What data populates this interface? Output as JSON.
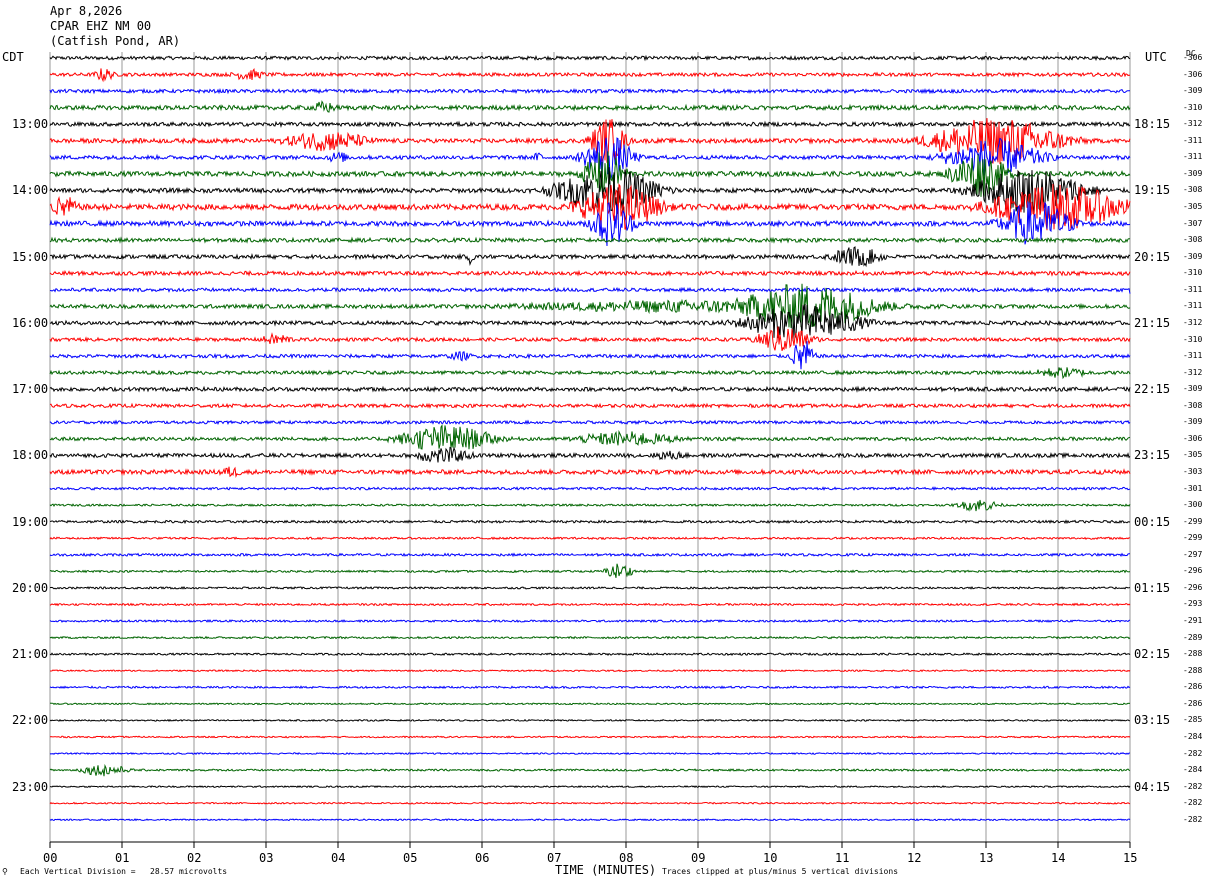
{
  "header": {
    "date": "Apr 8,2026",
    "station": "CPAR EHZ NM 00",
    "location": "(Catfish Pond, AR)"
  },
  "footer": {
    "scale_note": "Each Vertical Division =   28.57 microvolts",
    "clip_note": "Traces clipped at plus/minus 5 vertical divisions"
  },
  "chart_data": {
    "type": "line",
    "title": "CPAR EHZ NM 00 (Catfish Pond, AR) Apr 8,2026",
    "xlabel": "TIME (MINUTES)",
    "x_ticks": [
      "00",
      "01",
      "02",
      "03",
      "04",
      "05",
      "06",
      "07",
      "08",
      "09",
      "10",
      "11",
      "12",
      "13",
      "14",
      "15"
    ],
    "xlim": [
      0,
      15
    ],
    "left_axis_label": "CDT",
    "right_axis_label": "UTC",
    "dc_label": "DC",
    "trace_minutes": 15,
    "trace_colors": [
      "#000000",
      "#ff0000",
      "#0000ff",
      "#006400"
    ],
    "hour_labels_cdt": [
      "13:00",
      "14:00",
      "15:00",
      "16:00",
      "17:00",
      "18:00",
      "19:00",
      "20:00",
      "21:00",
      "22:00",
      "23:00"
    ],
    "hour_labels_utc": [
      "18:15",
      "19:15",
      "20:15",
      "21:15",
      "22:15",
      "23:15",
      "00:15",
      "01:15",
      "02:15",
      "03:15",
      "04:15"
    ],
    "dc_offsets": [
      "-306",
      "-306",
      "-309",
      "-310",
      "-312",
      "-311",
      "-311",
      "-309",
      "-308",
      "-305",
      "-307",
      "-308",
      "-309",
      "-310",
      "-311",
      "-311",
      "-312",
      "-310",
      "-311",
      "-312",
      "-309",
      "-308",
      "-309",
      "-306",
      "-305",
      "-303",
      "-301",
      "-300",
      "-299",
      "-299",
      "-297",
      "-296",
      "-296",
      "-293",
      "-291",
      "-289",
      "-288",
      "-288",
      "-286",
      "-286",
      "-285",
      "-284",
      "-282",
      "-284",
      "-282",
      "-282",
      "-282"
    ],
    "trace_amplitude": [
      0.35,
      0.35,
      0.35,
      0.45,
      0.4,
      0.45,
      0.4,
      0.5,
      0.45,
      0.6,
      0.5,
      0.4,
      0.4,
      0.4,
      0.35,
      0.4,
      0.4,
      0.35,
      0.35,
      0.35,
      0.4,
      0.35,
      0.3,
      0.35,
      0.4,
      0.45,
      0.25,
      0.2,
      0.25,
      0.2,
      0.25,
      0.2,
      0.2,
      0.2,
      0.2,
      0.2,
      0.2,
      0.15,
      0.2,
      0.15,
      0.15,
      0.15,
      0.15,
      0.2,
      0.15,
      0.15,
      0.15
    ],
    "events": [
      {
        "trace": 1,
        "start_min": 0.6,
        "end_min": 0.9,
        "peak": 1.5
      },
      {
        "trace": 1,
        "start_min": 2.5,
        "end_min": 3.0,
        "peak": 1.3
      },
      {
        "trace": 3,
        "start_min": 3.6,
        "end_min": 4.0,
        "peak": 1.4
      },
      {
        "trace": 5,
        "start_min": 3.2,
        "end_min": 4.5,
        "peak": 2.2
      },
      {
        "trace": 6,
        "start_min": 3.8,
        "end_min": 4.2,
        "peak": 1.2
      },
      {
        "trace": 6,
        "start_min": 6.7,
        "end_min": 6.9,
        "peak": 1.2
      },
      {
        "trace": 5,
        "start_min": 7.5,
        "end_min": 8.0,
        "peak": 5
      },
      {
        "trace": 6,
        "start_min": 7.4,
        "end_min": 8.1,
        "peak": 5
      },
      {
        "trace": 7,
        "start_min": 7.4,
        "end_min": 8.0,
        "peak": 5
      },
      {
        "trace": 8,
        "start_min": 7.0,
        "end_min": 8.5,
        "peak": 5
      },
      {
        "trace": 9,
        "start_min": 7.3,
        "end_min": 8.5,
        "peak": 5
      },
      {
        "trace": 10,
        "start_min": 7.5,
        "end_min": 8.1,
        "peak": 5
      },
      {
        "trace": 5,
        "start_min": 12.2,
        "end_min": 14.1,
        "peak": 5
      },
      {
        "trace": 6,
        "start_min": 12.4,
        "end_min": 13.8,
        "peak": 4
      },
      {
        "trace": 7,
        "start_min": 12.5,
        "end_min": 13.3,
        "peak": 5
      },
      {
        "trace": 8,
        "start_min": 12.8,
        "end_min": 14.4,
        "peak": 5
      },
      {
        "trace": 9,
        "start_min": 13.0,
        "end_min": 15.0,
        "peak": 5
      },
      {
        "trace": 10,
        "start_min": 13.2,
        "end_min": 14.2,
        "peak": 5
      },
      {
        "trace": 9,
        "start_min": 0.0,
        "end_min": 0.4,
        "peak": 2.5
      },
      {
        "trace": 12,
        "start_min": 10.8,
        "end_min": 11.6,
        "peak": 2.2
      },
      {
        "trace": 12,
        "start_min": 5.8,
        "end_min": 5.9,
        "peak": 2.0
      },
      {
        "trace": 14,
        "start_min": 15.0,
        "end_min": 15.0,
        "peak": 1.0
      },
      {
        "trace": 15,
        "start_min": 6.0,
        "end_min": 12.5,
        "peak": 1.4
      },
      {
        "trace": 15,
        "start_min": 9.5,
        "end_min": 11.5,
        "peak": 5
      },
      {
        "trace": 16,
        "start_min": 9.6,
        "end_min": 11.3,
        "peak": 4
      },
      {
        "trace": 17,
        "start_min": 9.8,
        "end_min": 10.6,
        "peak": 3
      },
      {
        "trace": 18,
        "start_min": 10.3,
        "end_min": 10.6,
        "peak": 4
      },
      {
        "trace": 17,
        "start_min": 2.9,
        "end_min": 3.4,
        "peak": 1.3
      },
      {
        "trace": 18,
        "start_min": 5.5,
        "end_min": 5.9,
        "peak": 1.0
      },
      {
        "trace": 19,
        "start_min": 13.6,
        "end_min": 14.5,
        "peak": 1.2
      },
      {
        "trace": 23,
        "start_min": 4.8,
        "end_min": 6.2,
        "peak": 3
      },
      {
        "trace": 23,
        "start_min": 7.2,
        "end_min": 8.8,
        "peak": 1.6
      },
      {
        "trace": 24,
        "start_min": 5.0,
        "end_min": 5.9,
        "peak": 1.8
      },
      {
        "trace": 24,
        "start_min": 8.3,
        "end_min": 8.9,
        "peak": 1.0
      },
      {
        "trace": 25,
        "start_min": 2.3,
        "end_min": 2.7,
        "peak": 1.2
      },
      {
        "trace": 27,
        "start_min": 12.6,
        "end_min": 13.2,
        "peak": 1.4
      },
      {
        "trace": 31,
        "start_min": 7.7,
        "end_min": 8.1,
        "peak": 1.8
      },
      {
        "trace": 43,
        "start_min": 0.4,
        "end_min": 1.1,
        "peak": 1.3
      }
    ]
  }
}
